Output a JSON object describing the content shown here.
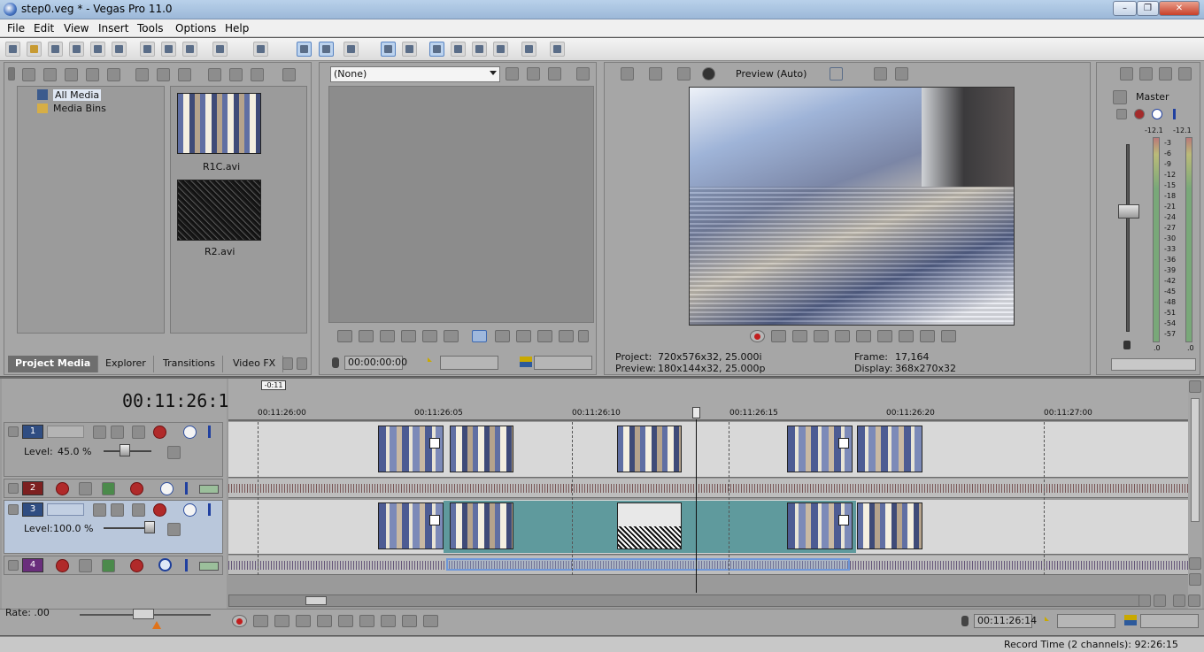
{
  "window": {
    "title": "step0.veg * - Vegas Pro 11.0"
  },
  "menu": [
    "File",
    "Edit",
    "View",
    "Insert",
    "Tools",
    "Options",
    "Help"
  ],
  "media": {
    "tree": [
      "All Media",
      "Media Bins"
    ],
    "files": [
      {
        "name": "R1C.avi"
      },
      {
        "name": "R2.avi"
      }
    ]
  },
  "tabs": [
    "Project Media",
    "Explorer",
    "Transitions",
    "Video FX"
  ],
  "trimmer": {
    "dropdown": "(None)",
    "timecode": "00:00:00:00"
  },
  "preview": {
    "mode": "Preview (Auto)",
    "project_label": "Project:",
    "project_value": "720x576x32, 25.000i",
    "preview_label": "Preview:",
    "preview_value": "180x144x32, 25.000p",
    "frame_label": "Frame:",
    "frame_value": "17,164",
    "display_label": "Display:",
    "display_value": "368x270x32"
  },
  "mixer": {
    "title": "Master",
    "peak_left": "-12.1",
    "peak_right": "-12.1",
    "scale": [
      "3",
      "6",
      "9",
      "12",
      "15",
      "18",
      "21",
      "24",
      "27",
      "30",
      "33",
      "36",
      "39",
      "42",
      "45",
      "48",
      "51",
      "54",
      "57"
    ],
    "bottom_left": ".0",
    "bottom_right": ".0"
  },
  "timeline": {
    "current_time": "00:11:26:14",
    "cursor_offset": "-0:11",
    "ruler": [
      "00:11:26:00",
      "00:11:26:05",
      "00:11:26:10",
      "00:11:26:15",
      "00:11:26:20",
      "00:11:27:00"
    ]
  },
  "tracks": [
    {
      "num": "1",
      "kind": "video",
      "level_label": "Level:",
      "level_value": "45.0 %"
    },
    {
      "num": "2",
      "kind": "audio"
    },
    {
      "num": "3",
      "kind": "video",
      "level_label": "Level:",
      "level_value": "100.0 %"
    },
    {
      "num": "4",
      "kind": "audio"
    }
  ],
  "transport": {
    "rate": "Rate: .00",
    "timecode": "00:11:26:14"
  },
  "status": {
    "record_time": "Record Time (2 channels): 92:26:15"
  },
  "colors": {
    "accent": "#3c68b0",
    "track_video_num": "#2f4d82",
    "track_audio_num": "#7d2020",
    "selection": "#5f9a9d"
  }
}
